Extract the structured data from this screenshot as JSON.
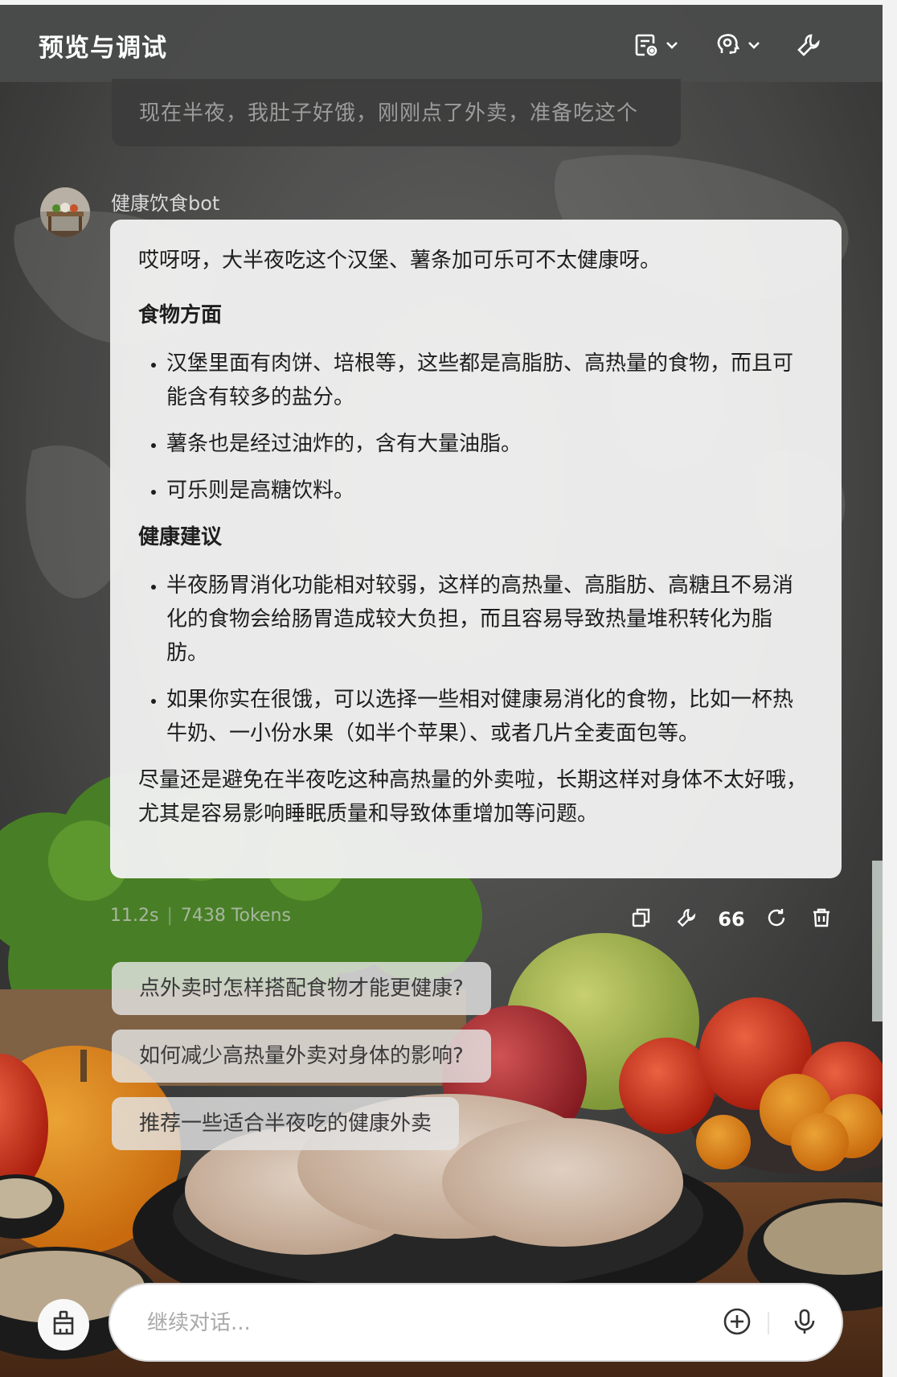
{
  "header": {
    "title": "预览与调试",
    "icons": [
      "memory-settings-icon",
      "chevron-down-icon",
      "voice-settings-icon",
      "chevron-down-icon",
      "wrench-icon"
    ]
  },
  "conversation": {
    "user_message": "现在半夜，我肚子好饿，刚刚点了外卖，准备吃这个",
    "bot_name": "健康饮食bot",
    "bot_reply": {
      "intro": "哎呀呀，大半夜吃这个汉堡、薯条加可乐可不太健康呀。",
      "section1_title": "食物方面",
      "section1_items": [
        "汉堡里面有肉饼、培根等，这些都是高脂肪、高热量的食物，而且可能含有较多的盐分。",
        "薯条也是经过油炸的，含有大量油脂。",
        "可乐则是高糖饮料。"
      ],
      "section2_title": "健康建议",
      "section2_items": [
        "半夜肠胃消化功能相对较弱，这样的高热量、高脂肪、高糖且不易消化的食物会给肠胃造成较大负担，而且容易导致热量堆积转化为脂肪。",
        "如果你实在很饿，可以选择一些相对健康易消化的食物，比如一杯热牛奶、一小份水果（如半个苹果）、或者几片全麦面包等。"
      ],
      "closing": "尽量还是避免在半夜吃这种高热量的外卖啦，长期这样对身体不太好哦，尤其是容易影响睡眠质量和导致体重增加等问题。"
    },
    "meta": {
      "duration": "11.2s",
      "separator": "|",
      "tokens": "7438 Tokens"
    },
    "actions": {
      "quote_label": "66"
    },
    "suggestions": [
      "点外卖时怎样搭配食物才能更健康?",
      "如何减少高热量外卖对身体的影响?",
      "推荐一些适合半夜吃的健康外卖"
    ]
  },
  "input": {
    "placeholder": "继续对话..."
  },
  "colors": {
    "header_bg": "#4a4b4b",
    "bubble_bg": "#f2f2f2",
    "suggestion_bg": "#e4e4e4"
  }
}
